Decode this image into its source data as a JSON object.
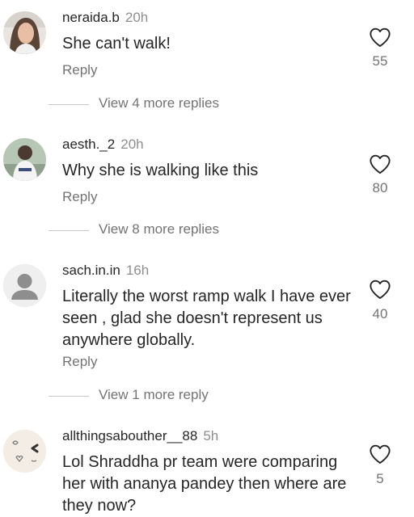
{
  "comments": [
    {
      "username": "neraida.b",
      "time": "20h",
      "text": "She can't walk!",
      "reply_label": "Reply",
      "likes": "55",
      "view_more": "View 4 more replies",
      "avatar_icon": "profile-photo"
    },
    {
      "username": "aesth._2",
      "time": "20h",
      "text": "Why she is walking like this",
      "reply_label": "Reply",
      "likes": "80",
      "view_more": "View 8 more replies",
      "avatar_icon": "profile-photo"
    },
    {
      "username": "sach.in.in",
      "time": "16h",
      "text": "Literally the worst ramp walk I have ever seen , glad she doesn't represent us anywhere globally.",
      "reply_label": "Reply",
      "likes": "40",
      "view_more": "View 1 more reply",
      "avatar_icon": "default-user-icon"
    },
    {
      "username": "allthingsabouther__88",
      "time": "5h",
      "text": "Lol Shraddha pr team were comparing her with ananya pandey then where are they now?",
      "likes": "5",
      "avatar_icon": "doodle-avatar"
    }
  ],
  "colors": {
    "text": "#262626",
    "secondary": "#737373",
    "divider": "#c7c7c7",
    "avatar_placeholder": "#dbdbdb"
  }
}
